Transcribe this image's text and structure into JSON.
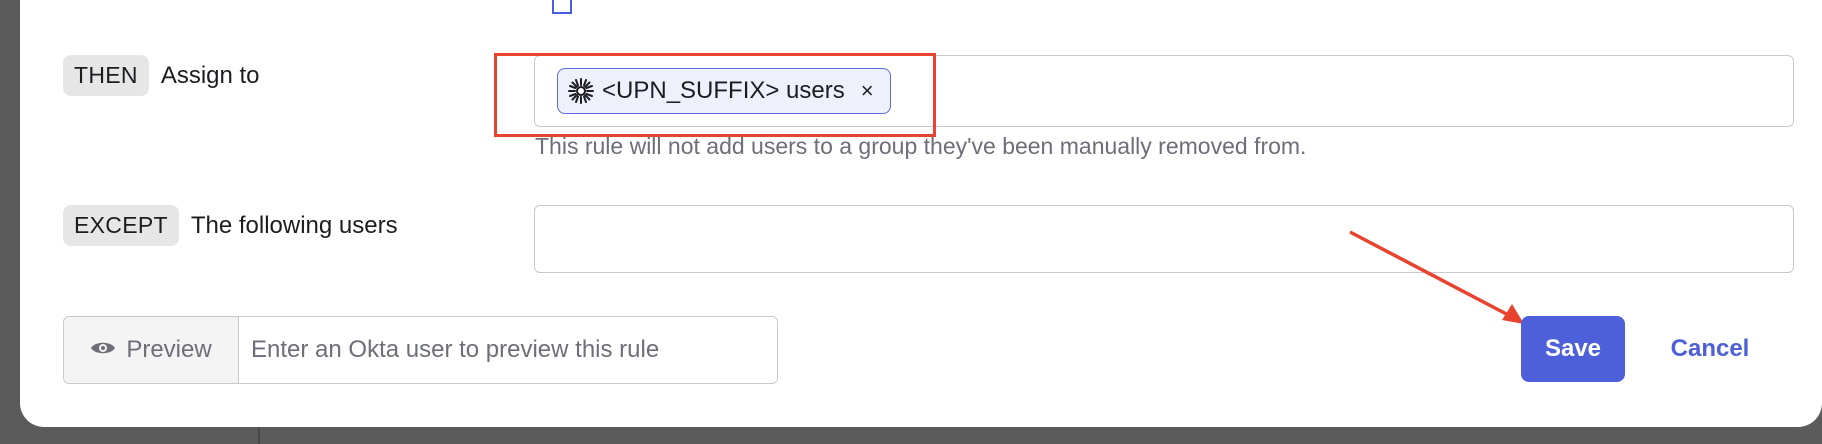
{
  "top_link": {
    "text": ""
  },
  "then_row": {
    "badge": "THEN",
    "label": "Assign to",
    "chip": {
      "label": "<UPN_SUFFIX> users",
      "remove": "×"
    },
    "helper": "This rule will not add users to a group they've been manually removed from."
  },
  "except_row": {
    "badge": "EXCEPT",
    "label": "The following users",
    "value": ""
  },
  "preview": {
    "button_label": "Preview",
    "placeholder": "Enter an Okta user to preview this rule"
  },
  "actions": {
    "save_label": "Save",
    "cancel_label": "Cancel"
  },
  "colors": {
    "accent": "#4d5fd9",
    "annotation": "#e8432e",
    "chip_bg": "#eef0fb"
  },
  "icons": [
    "okta-sunburst-icon",
    "eye-icon",
    "close-icon",
    "external-link-icon"
  ]
}
